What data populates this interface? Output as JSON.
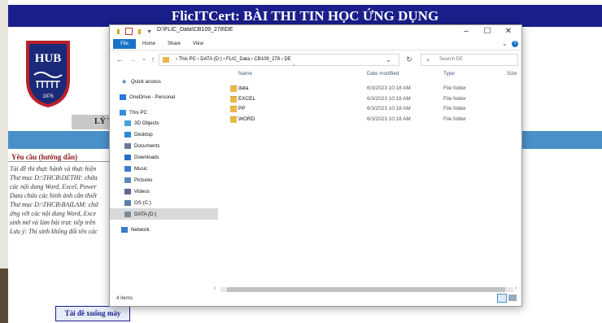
{
  "page": {
    "title": "FlicITCert: BÀI THI TIN HỌC ỨNG DỤNG",
    "tab_label": "LÝ T",
    "requirements_title": "Yêu cầu (hướng dẫn)",
    "requirements_lines": [
      "Tài đề thi thực hành và thực hiện",
      "Thư mục D:\\THCB\\DETHI: chứa",
      "các nội dung Word, Excel, Power",
      "Data chứa các hình ảnh cần thiết",
      "Thư mục D:\\THCB\\BAILAM: chứ",
      "ứng với các nội dung Word, Exce",
      "sinh mở và làm bài trực tiếp trên",
      "Lưu ý: Thí sinh không đổi tên các"
    ],
    "download_button": "Tải đề xuống máy",
    "logo": {
      "text": "HUB",
      "year": "1976"
    }
  },
  "explorer": {
    "title": "D:\\FLIC_Data\\CB109_278\\DE",
    "ribbon_tabs": [
      "File",
      "Home",
      "Share",
      "View"
    ],
    "address": [
      "This PC",
      "DATA (D:)",
      "FLIC_Data",
      "CB109_278",
      "DE"
    ],
    "search_placeholder": "Search DE",
    "nav_items": [
      {
        "label": "Quick access",
        "icon": "star-icon",
        "color": "#3a78c8"
      },
      {
        "label": "OneDrive - Personal",
        "icon": "cloud-icon",
        "color": "#2a7ad8"
      },
      {
        "label": "This PC",
        "icon": "computer-icon",
        "color": "#3a8ad8"
      },
      {
        "label": "3D Objects",
        "icon": "cube-icon",
        "color": "#4aa0e0"
      },
      {
        "label": "Desktop",
        "icon": "desktop-icon",
        "color": "#2a88d8"
      },
      {
        "label": "Documents",
        "icon": "document-icon",
        "color": "#6a7a9a"
      },
      {
        "label": "Downloads",
        "icon": "download-icon",
        "color": "#2a6ac8"
      },
      {
        "label": "Music",
        "icon": "music-icon",
        "color": "#3a7ad0"
      },
      {
        "label": "Pictures",
        "icon": "picture-icon",
        "color": "#5a8ab8"
      },
      {
        "label": "Videos",
        "icon": "video-icon",
        "color": "#5a6a8a"
      },
      {
        "label": "OS (C:)",
        "icon": "drive-icon",
        "color": "#5a7aa8"
      },
      {
        "label": "DATA (D:)",
        "icon": "drive-icon",
        "color": "#7a8a9a"
      },
      {
        "label": "Network",
        "icon": "network-icon",
        "color": "#3a7ac8"
      }
    ],
    "columns": {
      "name": "Name",
      "date": "Date modified",
      "type": "Type",
      "size": "Size"
    },
    "rows": [
      {
        "name": "data",
        "date": "6/3/2023 10:18 AM",
        "type": "File folder"
      },
      {
        "name": "EXCEL",
        "date": "6/3/2023 10:18 AM",
        "type": "File folder"
      },
      {
        "name": "PP",
        "date": "6/3/2023 10:18 AM",
        "type": "File folder"
      },
      {
        "name": "WORD",
        "date": "6/3/2023 10:18 AM",
        "type": "File folder"
      }
    ],
    "status": "4 items",
    "colors": {
      "accent": "#1a73c8",
      "folder": "#e8b84a",
      "selected": "#d9d9d9"
    }
  }
}
